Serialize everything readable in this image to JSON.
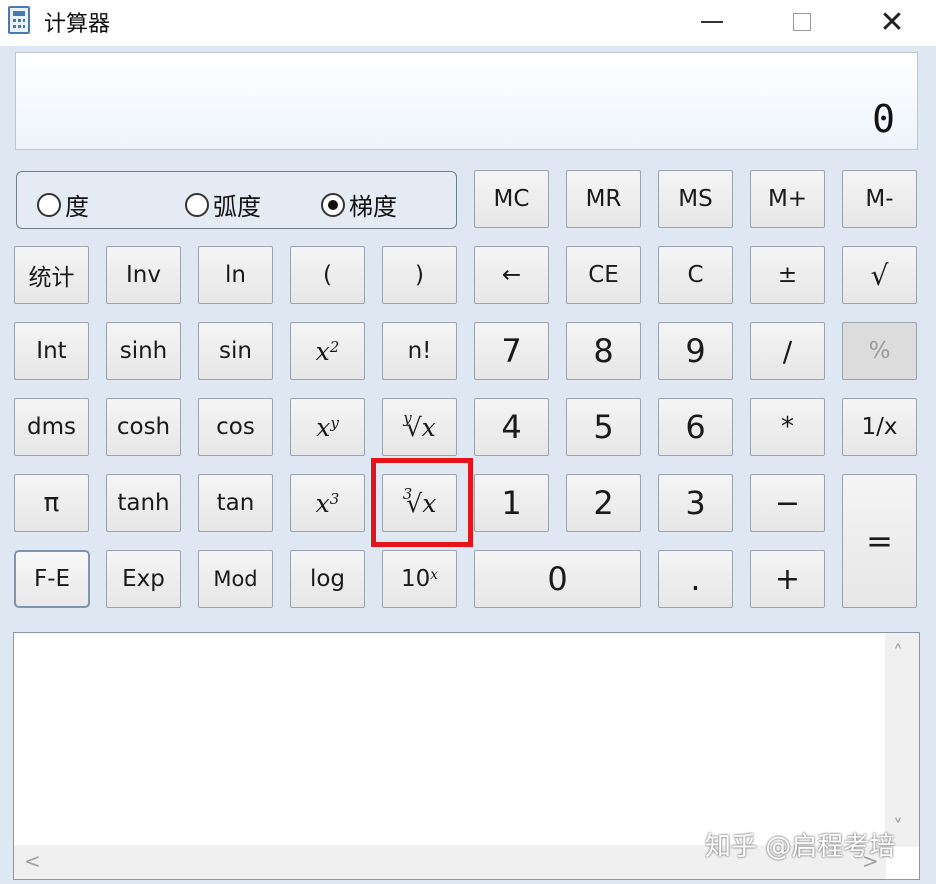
{
  "window": {
    "title": "计算器",
    "minimize_icon": "minimize-icon",
    "maximize_icon": "maximize-icon",
    "close_symbol": "✕"
  },
  "display": {
    "value": "0"
  },
  "angle_mode": {
    "options": [
      "度",
      "弧度",
      "梯度"
    ],
    "selected": "梯度"
  },
  "buttons": {
    "mc": "MC",
    "mr": "MR",
    "ms": "MS",
    "m_plus": "M+",
    "m_minus": "M-",
    "stat": "统计",
    "inv": "Inv",
    "ln": "ln",
    "lparen": "(",
    "rparen": ")",
    "backspace": "←",
    "ce": "CE",
    "c": "C",
    "plusminus": "±",
    "sqrt": "√",
    "int": "Int",
    "sinh": "sinh",
    "sin": "sin",
    "x2_base": "x",
    "x2_exp": "2",
    "fact": "n!",
    "d7": "7",
    "d8": "8",
    "d9": "9",
    "divide": "/",
    "percent": "%",
    "dms": "dms",
    "cosh": "cosh",
    "cos": "cos",
    "xy_base": "x",
    "xy_exp": "y",
    "yroot_index": "y",
    "yroot_sym": "√",
    "yroot_base": "x",
    "d4": "4",
    "d5": "5",
    "d6": "6",
    "multiply": "*",
    "reciprocal": "1/x",
    "pi": "π",
    "tanh": "tanh",
    "tan": "tan",
    "x3_base": "x",
    "x3_exp": "3",
    "croot_index": "3",
    "croot_sym": "√",
    "croot_base": "x",
    "d1": "1",
    "d2": "2",
    "d3": "3",
    "minus": "−",
    "equals": "=",
    "fe": "F-E",
    "exp": "Exp",
    "mod": "Mod",
    "log": "log",
    "ten_base": "10",
    "ten_exp": "x",
    "d0": "0",
    "decimal": ".",
    "plus": "+"
  },
  "history": {
    "scroll_up": "˄",
    "scroll_down": "˅",
    "scroll_left": "<",
    "scroll_right": ">"
  },
  "watermark": "知乎 @启程考培",
  "colors": {
    "highlight": "#e5141b",
    "background": "#dfe7f2"
  }
}
